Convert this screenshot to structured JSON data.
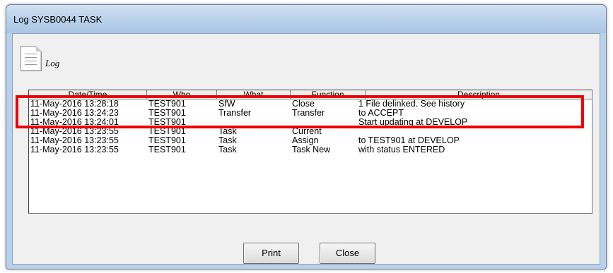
{
  "window": {
    "title": "Log SYSB0044 TASK"
  },
  "header": {
    "icon": "document-icon",
    "label": "Log"
  },
  "table": {
    "columns": [
      "Date/Time",
      "Who",
      "What",
      "Function",
      "Description"
    ],
    "rows": [
      [
        "11-May-2016 13:28:18",
        "TEST901",
        "SfW",
        "Close",
        "1 File delinked. See history"
      ],
      [
        "11-May-2016 13:24:23",
        "TEST901",
        "Transfer",
        "Transfer",
        "to ACCEPT"
      ],
      [
        "11-May-2016 13:24:01",
        "TEST901",
        "",
        "",
        "Start updating at DEVELOP"
      ],
      [
        "11-May-2016 13:23:55",
        "TEST901",
        "Task",
        "Current",
        ""
      ],
      [
        "11-May-2016 13:23:55",
        "TEST901",
        "Task",
        "Assign",
        "to TEST901 at DEVELOP"
      ],
      [
        "11-May-2016 13:23:55",
        "TEST901",
        "Task",
        "Task New",
        "with status ENTERED"
      ]
    ]
  },
  "buttons": {
    "print": "Print",
    "close": "Close"
  },
  "annotation": {
    "highlight_color": "#ee0000"
  }
}
